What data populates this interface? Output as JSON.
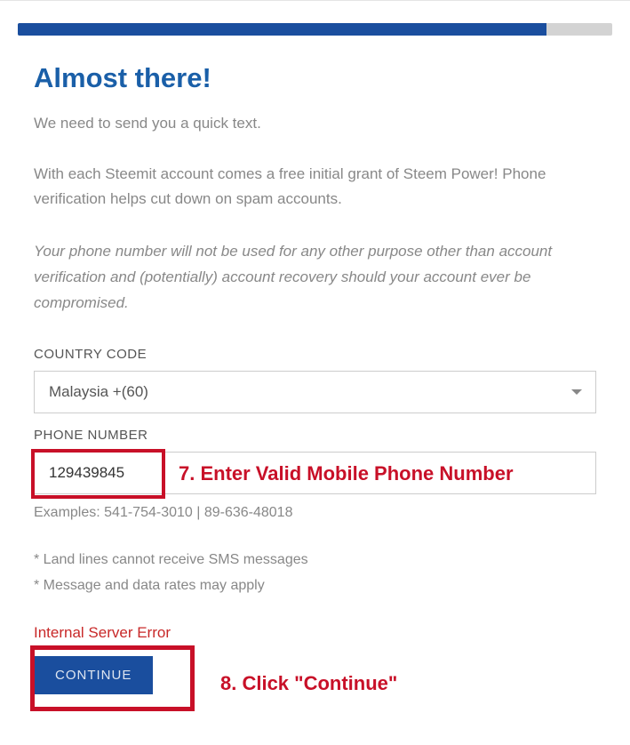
{
  "progress": {
    "percent": 89
  },
  "heading": "Almost there!",
  "subtitle": "We need to send you a quick text.",
  "info": "With each Steemit account comes a free initial grant of Steem Power! Phone verification helps cut down on spam accounts.",
  "disclaimer": "Your phone number will not be used for any other purpose other than account verification and (potentially) account recovery should your account ever be compromised.",
  "fields": {
    "country_label": "COUNTRY CODE",
    "country_value": "Malaysia +(60)",
    "phone_label": "PHONE NUMBER",
    "phone_value": "129439845",
    "examples": "Examples: 541-754-3010 | 89-636-48018"
  },
  "notes": {
    "line1": "* Land lines cannot receive SMS messages",
    "line2": "* Message and data rates may apply"
  },
  "error": "Internal Server Error",
  "buttons": {
    "continue": "CONTINUE"
  },
  "annotations": {
    "phone": "7. Enter Valid Mobile Phone Number",
    "continue": "8. Click \"Continue\""
  }
}
